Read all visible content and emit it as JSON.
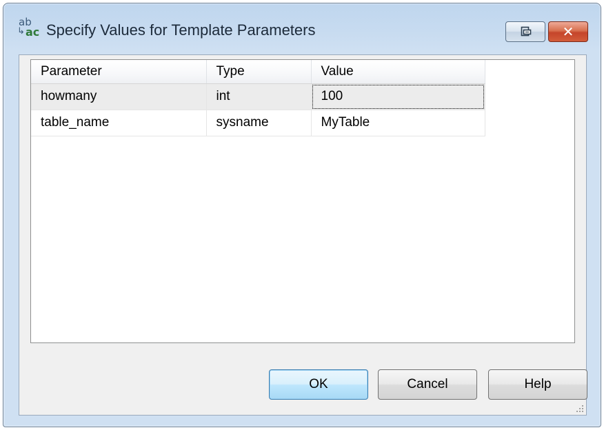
{
  "window": {
    "title": "Specify Values for Template Parameters",
    "icon": "template-parameters-icon",
    "icon_text_top": "ab",
    "icon_text_bottom": "ac",
    "restore_icon": "restore-icon",
    "close_icon": "close-icon"
  },
  "grid": {
    "columns": [
      "Parameter",
      "Type",
      "Value"
    ],
    "rows": [
      {
        "parameter": "howmany",
        "type": "int",
        "value": "100"
      },
      {
        "parameter": "table_name",
        "type": "sysname",
        "value": "MyTable"
      }
    ],
    "selected_row": 0
  },
  "buttons": {
    "ok": "OK",
    "cancel": "Cancel",
    "help": "Help"
  },
  "colors": {
    "selected_row": "#ececec",
    "default_button": "#bee6fd",
    "close_button": "#c5452a"
  }
}
